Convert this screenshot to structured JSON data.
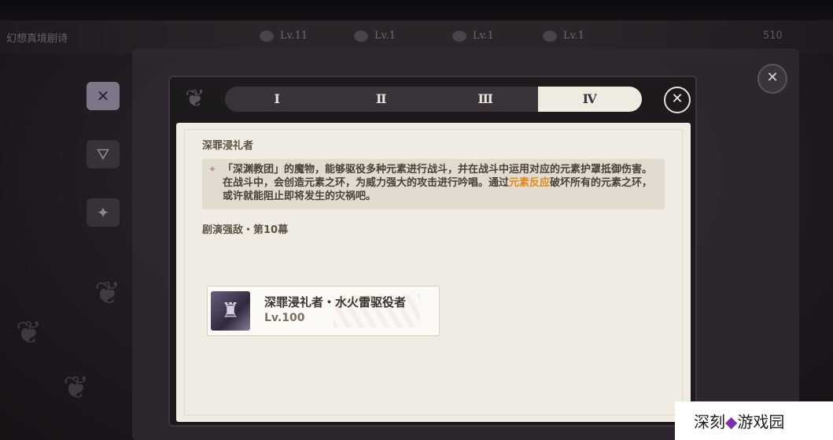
{
  "header": {
    "title": "幻想真境剧诗",
    "levels": [
      "Lv.11",
      "Lv.1",
      "Lv.1",
      "Lv.1"
    ],
    "counter": "510"
  },
  "dialog": {
    "tabs": [
      {
        "label": "Ⅰ",
        "active": false
      },
      {
        "label": "Ⅱ",
        "active": false
      },
      {
        "label": "Ⅲ",
        "active": false
      },
      {
        "label": "Ⅳ",
        "active": true
      }
    ],
    "enemy_name": "深罪浸礼者",
    "description_before": "「深渊教团」的魔物，能够驱役多种元素进行战斗，并在战斗中运用对应的元素护罩抵御伤害。在战斗中，会创造元素之环，为威力强大的攻击进行吟唱。通过",
    "description_highlight": "元素反应",
    "description_after": "破坏所有的元素之环，或许就能阻止即将发生的灾祸吧。",
    "section_title": "剧演强敌・第10幕",
    "enemy_card": {
      "name": "深罪浸礼者・水火雷驱役者",
      "level": "Lv.100"
    }
  },
  "watermark": {
    "before": "深刻",
    "mark": "◆",
    "after": "游戏园"
  },
  "colors": {
    "accent_highlight": "#e08a1c",
    "panel_bg": "#f1ece3",
    "tab_active_bg": "#f0ebe1"
  }
}
